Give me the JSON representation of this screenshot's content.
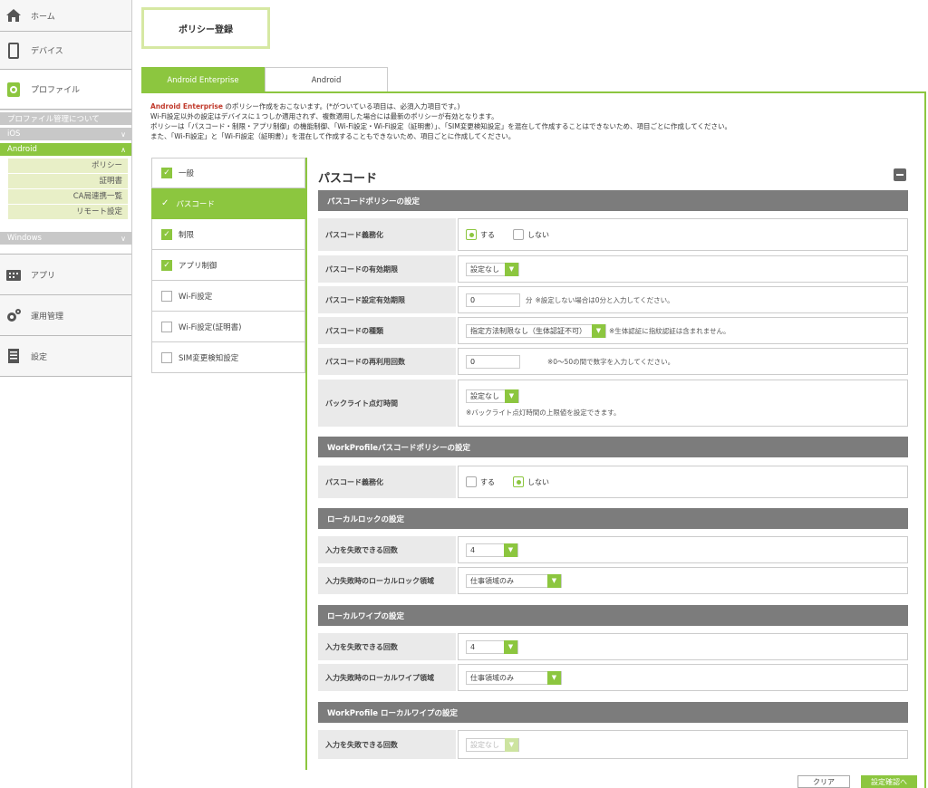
{
  "sidebar": {
    "home": "ホーム",
    "devices": "デバイス",
    "profiles": "プロファイル",
    "profile_about": "プロファイル管理について",
    "ios": "iOS",
    "android": "Android",
    "android_items": [
      "ポリシー",
      "証明書",
      "CA局連携一覧",
      "リモート設定"
    ],
    "windows": "Windows",
    "apps": "アプリ",
    "operations": "運用管理",
    "settings": "設定"
  },
  "page_title": "ポリシー登録",
  "tabs": [
    "Android Enterprise",
    "Android"
  ],
  "intro": {
    "brand": "Android Enterprise",
    "line1_rest": " のポリシー作成をおこないます。(*がついている項目は、必須入力項目です。)",
    "line2": "Wi-Fi設定以外の設定はデバイスに１つしか適用されず、複数適用した場合には最新のポリシーが有効となります。",
    "line3": "ポリシーは「パスコード・制限・アプリ制御」の機能制御、「Wi-Fi設定・Wi-Fi設定（証明書）」、「SIM変更検知設定」を混在して作成することはできないため、項目ごとに作成してください。",
    "line4": "また、「Wi-Fi設定」と「Wi-Fi設定（証明書）」を混在して作成することもできないため、項目ごとに作成してください。"
  },
  "left_menu": [
    "一般",
    "パスコード",
    "制限",
    "アプリ制御",
    "Wi-Fi設定",
    "Wi-Fi設定(証明書)",
    "SIM変更検知設定"
  ],
  "panel_title": "パスコード",
  "sections": {
    "passcode_policy": "パスコードポリシーの設定",
    "work_passcode_policy": "WorkProfileパスコードポリシーの設定",
    "local_lock": "ローカルロックの設定",
    "local_wipe": "ローカルワイプの設定",
    "work_local_wipe": "WorkProfile ローカルワイプの設定"
  },
  "rows": {
    "require": "パスコード義務化",
    "expiry": "パスコードの有効期限",
    "expiry_setting": "パスコード設定有効期限",
    "type": "パスコードの種類",
    "reuse": "パスコードの再利用回数",
    "backlight": "バックライト点灯時間",
    "work_require": "パスコード義務化",
    "lock_fail": "入力を失敗できる回数",
    "lock_area": "入力失敗時のローカルロック領域",
    "wipe_fail": "入力を失敗できる回数",
    "wipe_area": "入力失敗時のローカルワイプ領域",
    "work_wipe_fail": "入力を失敗できる回数"
  },
  "values": {
    "yes": "する",
    "no": "しない",
    "not_set": "設定なし",
    "minutes_value": "0",
    "minutes_unit": "分",
    "minutes_note": "※設定しない場合は0分と入力してください。",
    "type_value": "指定方法制限なし（生体認証不可）",
    "type_note": "※生体認証に指紋認証は含まれません。",
    "reuse_value": "0",
    "reuse_note": "※0～50の間で数字を入力してください。",
    "backlight_note": "※バックライト点灯時間の上限値を設定できます。",
    "lock_fail_value": "4",
    "lock_area_value": "仕事領域のみ",
    "wipe_fail_value": "4",
    "wipe_area_value": "仕事領域のみ",
    "work_wipe_value": "設定なし"
  },
  "buttons": {
    "clear": "クリア",
    "confirm": "設定確認へ"
  },
  "colors": {
    "accent": "#8cc63f",
    "section_bar": "#7c7c7c"
  }
}
